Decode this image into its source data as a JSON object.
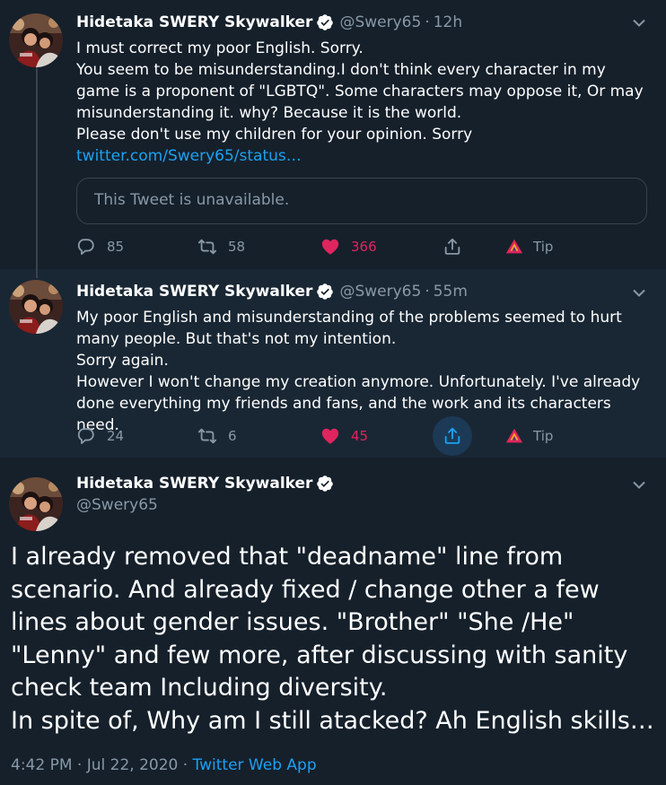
{
  "colors": {
    "background": "#15202b",
    "highlight_background": "#192734",
    "secondary_text": "#8899a6",
    "link": "#1da1f2",
    "like": "#e0245e",
    "border": "#38444d"
  },
  "tweets": [
    {
      "author_name": "Hidetaka SWERY Skywalker",
      "handle": "@Swery65",
      "separator": "·",
      "time": "12h",
      "lines": [
        "I must correct my poor English. Sorry.",
        "You seem to be misunderstanding.I don't think every character in my game is a proponent of \"LGBTQ\". Some characters may oppose it, Or may misunderstanding it. why? Because it is the world.",
        "Please don't use my children for your opinion. Sorry"
      ],
      "link": "twitter.com/Swery65/status…",
      "quoted_tweet": "This Tweet is unavailable.",
      "replies": "85",
      "retweets": "58",
      "likes": "366",
      "tip": "Tip"
    },
    {
      "author_name": "Hidetaka SWERY Skywalker",
      "handle": "@Swery65",
      "separator": "·",
      "time": "55m",
      "lines": [
        "My poor English and misunderstanding of the problems seemed to hurt many people. But that's not my intention.",
        "Sorry again.",
        "However I won't change my creation anymore. Unfortunately. I've already done everything my friends and fans, and the work and its characters need."
      ],
      "replies": "24",
      "retweets": "6",
      "likes": "45",
      "tip": "Tip"
    },
    {
      "author_name": "Hidetaka SWERY Skywalker",
      "handle": "@Swery65",
      "lines": [
        "I already removed that \"deadname\" line from scenario. And already fixed / change other a few lines about gender issues. \"Brother\" \"She /He\" \"Lenny\" and few more, after discussing with sanity check team Including diversity.",
        "In spite of, Why am I still atacked? Ah English skills…"
      ],
      "timestamp": "4:42 PM · Jul 22, 2020",
      "meta_separator": "·",
      "source_app": "Twitter Web App"
    }
  ]
}
